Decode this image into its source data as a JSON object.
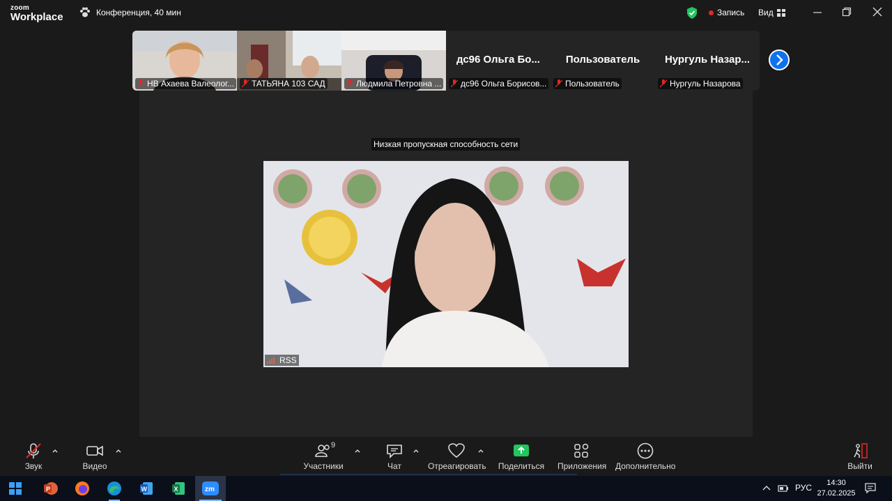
{
  "app": {
    "logo_top": "zoom",
    "logo_bottom": "Workplace",
    "meeting_title": "Конференция, 40 мин",
    "record_label": "Запись",
    "view_label": "Вид"
  },
  "participants": [
    {
      "name": "НВ Ахаева Валеолог...",
      "video": true,
      "muted": true
    },
    {
      "name": "ТАТЬЯНА 103 САД",
      "video": true,
      "muted": true
    },
    {
      "name": "Людмила Петровна ...",
      "video": true,
      "muted": true
    },
    {
      "name": "дс96 Ольга  Борисов...",
      "big_name": "дс96 Ольга  Бо...",
      "video": false,
      "muted": true
    },
    {
      "name": "Пользователь",
      "big_name": "Пользователь",
      "video": false,
      "muted": true
    },
    {
      "name": "Нургуль Назарова",
      "big_name": "Нургуль  Назар...",
      "video": false,
      "muted": true
    }
  ],
  "stage": {
    "warning": "Низкая пропускная способность сети",
    "speaker_label": "RSS"
  },
  "toolbar": {
    "audio": "Звук",
    "video": "Видео",
    "participants": "Участники",
    "participants_count": "9",
    "chat": "Чат",
    "react": "Отреагировать",
    "share": "Поделиться",
    "apps": "Приложения",
    "more": "Дополнительно",
    "leave": "Выйти"
  },
  "taskbar": {
    "lang": "РУС",
    "time": "14:30",
    "date": "27.02.2025",
    "apps": [
      "start-icon",
      "powerpoint-icon",
      "firefox-icon",
      "edge-icon",
      "word-icon",
      "excel-icon",
      "zoom-icon"
    ]
  },
  "colors": {
    "accent": "#0e72ed",
    "share_green": "#22c55e",
    "record_red": "#e02828",
    "muted_red": "#e02828"
  }
}
